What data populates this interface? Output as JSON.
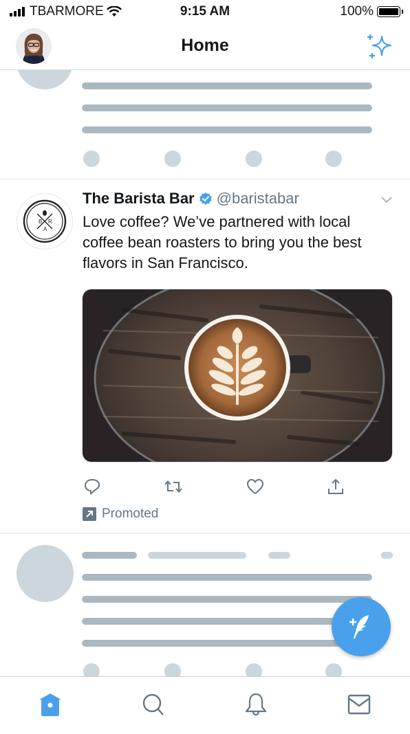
{
  "status_bar": {
    "carrier": "TBARMORE",
    "time": "9:15 AM",
    "battery_percent": "100%",
    "battery_level": 1.0
  },
  "header": {
    "title": "Home",
    "avatar_icon": "profile-avatar",
    "right_icon": "sparkle-icon"
  },
  "tweet": {
    "display_name": "The Barista Bar",
    "verified": true,
    "handle": "@baristabar",
    "text": "Love coffee? We’ve partnered with local coffee bean roasters to bring you the best flavors in San Francisco.",
    "avatar_letters": [
      "B",
      "R",
      "A"
    ],
    "media_description": "Latte art coffee cup on wooden table",
    "actions": [
      "reply-icon",
      "retweet-icon",
      "like-icon",
      "share-icon"
    ],
    "promoted_label": "Promoted"
  },
  "tab_bar": {
    "tabs": [
      {
        "name": "home",
        "icon": "home-icon",
        "active": true
      },
      {
        "name": "search",
        "icon": "search-icon",
        "active": false
      },
      {
        "name": "notifications",
        "icon": "bell-icon",
        "active": false
      },
      {
        "name": "messages",
        "icon": "mail-icon",
        "active": false
      }
    ]
  },
  "compose_button": {
    "icon": "compose-feather-icon"
  },
  "colors": {
    "accent": "#4aa1eb",
    "secondary_text": "#657786",
    "placeholder_dark": "#aab8c2",
    "placeholder_light": "#ccd6dd"
  }
}
